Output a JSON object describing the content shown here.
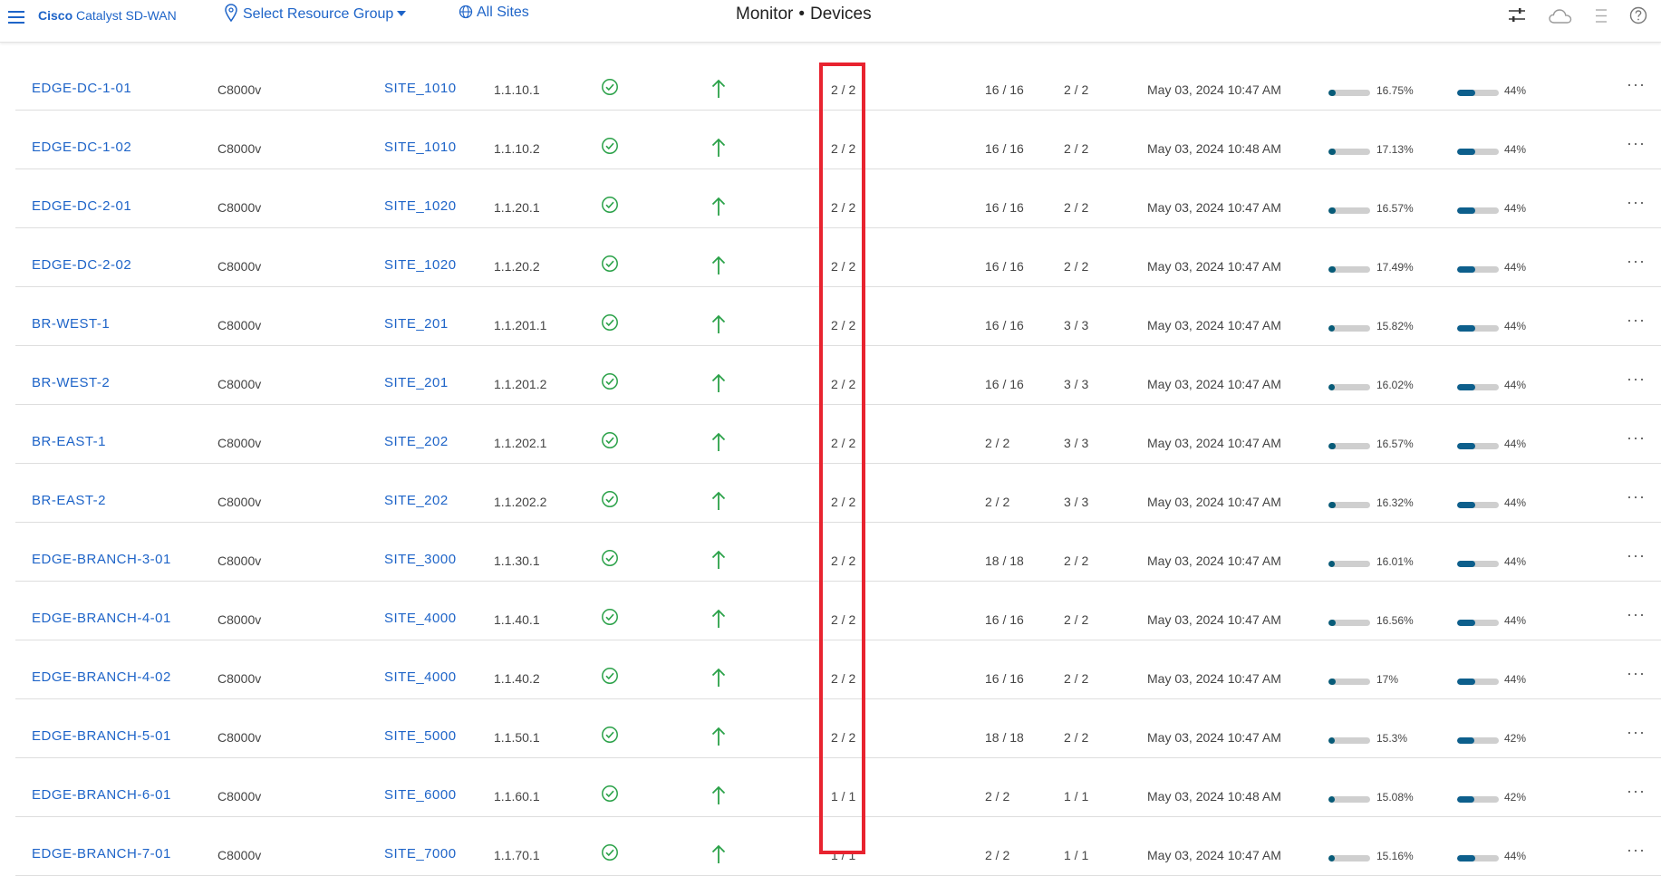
{
  "header": {
    "brand_bold": "Cisco",
    "brand_rest": "Catalyst SD-WAN",
    "resource_group": "Select Resource Group",
    "all_sites": "All Sites",
    "title_section": "Monitor",
    "title_sep": "•",
    "title_page": "Devices"
  },
  "icons": {
    "menu": "hamburger-menu-icon",
    "location": "map-pin-icon",
    "globe": "globe-icon",
    "filter": "sliders-icon",
    "cloud": "cloud-icon",
    "list": "task-list-icon",
    "help": "help-icon"
  },
  "colors": {
    "link": "#1e64c8",
    "success": "#2aa148",
    "highlight": "#e8232f",
    "bar_fill": "#0d5f8c"
  },
  "devices": [
    {
      "name": "EDGE-DC-1-01",
      "model": "C8000v",
      "site": "SITE_1010",
      "ip": "1.1.10.1",
      "bfd": "2 / 2",
      "control": "16 / 16",
      "tloc": "2 / 2",
      "uptime": "May 03, 2024 10:47 AM",
      "cpu": "16.75%",
      "cpu_pct": 16.75,
      "mem": "44%",
      "mem_pct": 44
    },
    {
      "name": "EDGE-DC-1-02",
      "model": "C8000v",
      "site": "SITE_1010",
      "ip": "1.1.10.2",
      "bfd": "2 / 2",
      "control": "16 / 16",
      "tloc": "2 / 2",
      "uptime": "May 03, 2024 10:48 AM",
      "cpu": "17.13%",
      "cpu_pct": 17.13,
      "mem": "44%",
      "mem_pct": 44
    },
    {
      "name": "EDGE-DC-2-01",
      "model": "C8000v",
      "site": "SITE_1020",
      "ip": "1.1.20.1",
      "bfd": "2 / 2",
      "control": "16 / 16",
      "tloc": "2 / 2",
      "uptime": "May 03, 2024 10:47 AM",
      "cpu": "16.57%",
      "cpu_pct": 16.57,
      "mem": "44%",
      "mem_pct": 44
    },
    {
      "name": "EDGE-DC-2-02",
      "model": "C8000v",
      "site": "SITE_1020",
      "ip": "1.1.20.2",
      "bfd": "2 / 2",
      "control": "16 / 16",
      "tloc": "2 / 2",
      "uptime": "May 03, 2024 10:47 AM",
      "cpu": "17.49%",
      "cpu_pct": 17.49,
      "mem": "44%",
      "mem_pct": 44
    },
    {
      "name": "BR-WEST-1",
      "model": "C8000v",
      "site": "SITE_201",
      "ip": "1.1.201.1",
      "bfd": "2 / 2",
      "control": "16 / 16",
      "tloc": "3 / 3",
      "uptime": "May 03, 2024 10:47 AM",
      "cpu": "15.82%",
      "cpu_pct": 15.82,
      "mem": "44%",
      "mem_pct": 44
    },
    {
      "name": "BR-WEST-2",
      "model": "C8000v",
      "site": "SITE_201",
      "ip": "1.1.201.2",
      "bfd": "2 / 2",
      "control": "16 / 16",
      "tloc": "3 / 3",
      "uptime": "May 03, 2024 10:47 AM",
      "cpu": "16.02%",
      "cpu_pct": 16.02,
      "mem": "44%",
      "mem_pct": 44
    },
    {
      "name": "BR-EAST-1",
      "model": "C8000v",
      "site": "SITE_202",
      "ip": "1.1.202.1",
      "bfd": "2 / 2",
      "control": "2 / 2",
      "tloc": "3 / 3",
      "uptime": "May 03, 2024 10:47 AM",
      "cpu": "16.57%",
      "cpu_pct": 16.57,
      "mem": "44%",
      "mem_pct": 44
    },
    {
      "name": "BR-EAST-2",
      "model": "C8000v",
      "site": "SITE_202",
      "ip": "1.1.202.2",
      "bfd": "2 / 2",
      "control": "2 / 2",
      "tloc": "3 / 3",
      "uptime": "May 03, 2024 10:47 AM",
      "cpu": "16.32%",
      "cpu_pct": 16.32,
      "mem": "44%",
      "mem_pct": 44
    },
    {
      "name": "EDGE-BRANCH-3-01",
      "model": "C8000v",
      "site": "SITE_3000",
      "ip": "1.1.30.1",
      "bfd": "2 / 2",
      "control": "18 / 18",
      "tloc": "2 / 2",
      "uptime": "May 03, 2024 10:47 AM",
      "cpu": "16.01%",
      "cpu_pct": 16.01,
      "mem": "44%",
      "mem_pct": 44
    },
    {
      "name": "EDGE-BRANCH-4-01",
      "model": "C8000v",
      "site": "SITE_4000",
      "ip": "1.1.40.1",
      "bfd": "2 / 2",
      "control": "16 / 16",
      "tloc": "2 / 2",
      "uptime": "May 03, 2024 10:47 AM",
      "cpu": "16.56%",
      "cpu_pct": 16.56,
      "mem": "44%",
      "mem_pct": 44
    },
    {
      "name": "EDGE-BRANCH-4-02",
      "model": "C8000v",
      "site": "SITE_4000",
      "ip": "1.1.40.2",
      "bfd": "2 / 2",
      "control": "16 / 16",
      "tloc": "2 / 2",
      "uptime": "May 03, 2024 10:47 AM",
      "cpu": "17%",
      "cpu_pct": 17,
      "mem": "44%",
      "mem_pct": 44
    },
    {
      "name": "EDGE-BRANCH-5-01",
      "model": "C8000v",
      "site": "SITE_5000",
      "ip": "1.1.50.1",
      "bfd": "2 / 2",
      "control": "18 / 18",
      "tloc": "2 / 2",
      "uptime": "May 03, 2024 10:47 AM",
      "cpu": "15.3%",
      "cpu_pct": 15.3,
      "mem": "42%",
      "mem_pct": 42
    },
    {
      "name": "EDGE-BRANCH-6-01",
      "model": "C8000v",
      "site": "SITE_6000",
      "ip": "1.1.60.1",
      "bfd": "1 / 1",
      "control": "2 / 2",
      "tloc": "1 / 1",
      "uptime": "May 03, 2024 10:48 AM",
      "cpu": "15.08%",
      "cpu_pct": 15.08,
      "mem": "42%",
      "mem_pct": 42
    },
    {
      "name": "EDGE-BRANCH-7-01",
      "model": "C8000v",
      "site": "SITE_7000",
      "ip": "1.1.70.1",
      "bfd": "1 / 1",
      "control": "2 / 2",
      "tloc": "1 / 1",
      "uptime": "May 03, 2024 10:47 AM",
      "cpu": "15.16%",
      "cpu_pct": 15.16,
      "mem": "44%",
      "mem_pct": 44
    }
  ]
}
